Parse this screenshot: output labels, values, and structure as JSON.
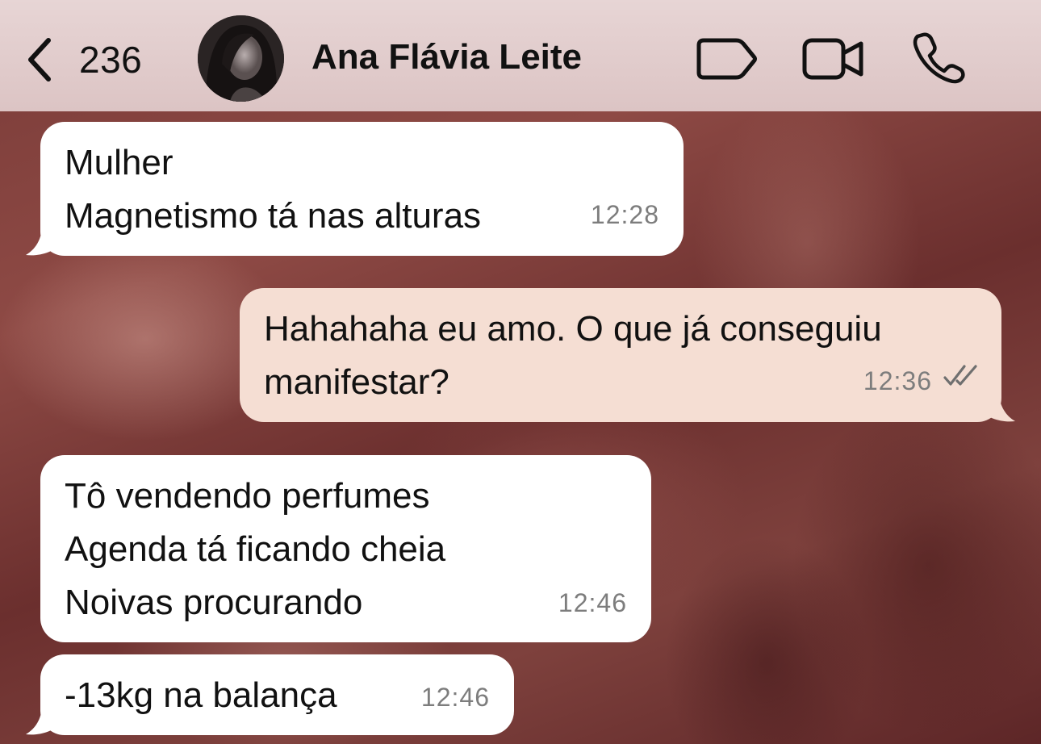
{
  "header": {
    "back_count": "236",
    "contact_name": "Ana Flávia Leite"
  },
  "messages": [
    {
      "direction": "incoming",
      "lines": [
        "Mulher",
        "Magnetismo tá nas alturas"
      ],
      "time": "12:28"
    },
    {
      "direction": "outgoing",
      "lines": [
        "Hahahaha eu amo. O que já conseguiu",
        "manifestar?"
      ],
      "time": "12:36",
      "status": "read"
    },
    {
      "direction": "incoming",
      "lines": [
        "Tô vendendo perfumes",
        "Agenda tá ficando cheia",
        "Noivas procurando"
      ],
      "time": "12:46"
    },
    {
      "direction": "incoming",
      "lines": [
        "-13kg na balança"
      ],
      "time": "12:46"
    }
  ],
  "colors": {
    "header_bg": "#e2cdcd",
    "incoming_bubble": "#ffffff",
    "outgoing_bubble": "#f5ded3",
    "timestamp": "#7d7d7d"
  },
  "icons": [
    "chevron-left-icon",
    "tag-icon",
    "video-camera-icon",
    "phone-icon",
    "double-check-icon"
  ]
}
